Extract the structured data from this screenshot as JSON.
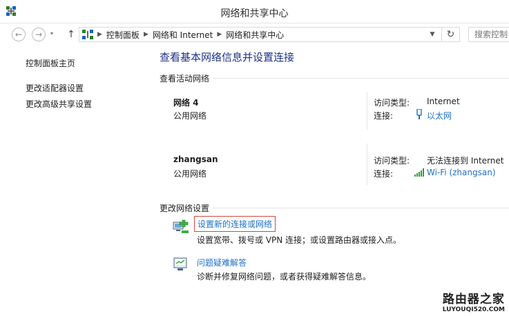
{
  "window": {
    "title": "网络和共享中心"
  },
  "address": {
    "crumbs": [
      "控制面板",
      "网络和 Internet",
      "网络和共享中心"
    ],
    "search_placeholder": "搜索控制"
  },
  "left_nav": {
    "home": "控制面板主页",
    "items": [
      "更改适配器设置",
      "更改高级共享设置"
    ]
  },
  "main": {
    "title": "查看基本网络信息并设置连接",
    "active_section": "查看活动网络",
    "networks": [
      {
        "name": "网络  4",
        "type": "公用网络",
        "access_label": "访问类型:",
        "access_value": "Internet",
        "conn_label": "连接:",
        "conn_value": "以太网"
      },
      {
        "name": "zhangsan",
        "type": "公用网络",
        "access_label": "访问类型:",
        "access_value": "无法连接到 Internet",
        "conn_label": "连接:",
        "conn_value": "Wi-Fi (zhangsan)"
      }
    ],
    "change_section": "更改网络设置",
    "tasks": [
      {
        "link": "设置新的连接或网络",
        "desc": "设置宽带、拨号或 VPN 连接；或设置路由器或接入点。"
      },
      {
        "link": "问题疑难解答",
        "desc": "诊断并修复网络问题，或者获得疑难解答信息。"
      }
    ]
  },
  "watermark": {
    "main": "路由器之家",
    "sub": "LUYOUQI520.COM"
  },
  "colors": {
    "accent_link": "#1e6fc8",
    "title_blue": "#1e3287",
    "highlight_box": "#d3463b"
  }
}
